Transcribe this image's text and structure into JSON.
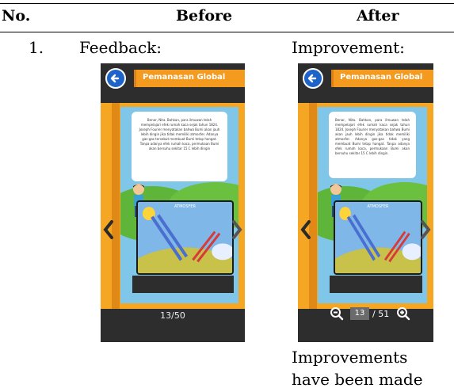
{
  "table": {
    "headers": {
      "no": "No.",
      "before": "Before",
      "after": "After"
    },
    "row": {
      "number": "1.",
      "before_label": "Feedback:",
      "after_label": "Improvement:",
      "after_note_line1": "Improvements",
      "after_note_line2": "have been made"
    }
  },
  "before_screen": {
    "title": "Pemanasan Global",
    "bubble_text": "Benar, Nita. Bahkan, para ilmuwan telah mempelajari efek rumah kaca sejak tahun 1824. Joseph Fourier menyatakan bahwa Bumi akan jauh lebih dingin jika tidak memiliki atmosfer. Adanya gas-gas tersebut membuat Bumi tetap hangat. Tanpa adanya efek rumah kaca, permukaan Bumi akan bersuhu sekitar 15 C lebih dingin",
    "info_label": "ATMOSFER",
    "page_indicator": "13/50"
  },
  "after_screen": {
    "title": "Pemanasan Global",
    "bubble_text": "Benar, Nita. Bahkan, para ilmuwan telah mempelajari efek rumah kaca sejak tahun 1824. Joseph Fourier menyatakan bahwa Bumi akan jauh lebih dingin jika tidak memiliki atmosfer. Adanya gas-gas tidak yang membuat Bumi tetap hangat. Tanpa adanya efek rumah kaca, permukaan Bumi akan bersuhu sekitar 15 C lebih dingin.",
    "info_label": "ATMOSFER",
    "current_page": "13",
    "total_pages": "/ 51"
  },
  "colors": {
    "accent_orange": "#f39a1f",
    "back_blue": "#1e63c8",
    "dark_bg": "#2d2d2d"
  },
  "icons": [
    "back-arrow-icon",
    "chevron-left-icon",
    "chevron-right-icon",
    "zoom-out-icon",
    "zoom-in-icon"
  ]
}
